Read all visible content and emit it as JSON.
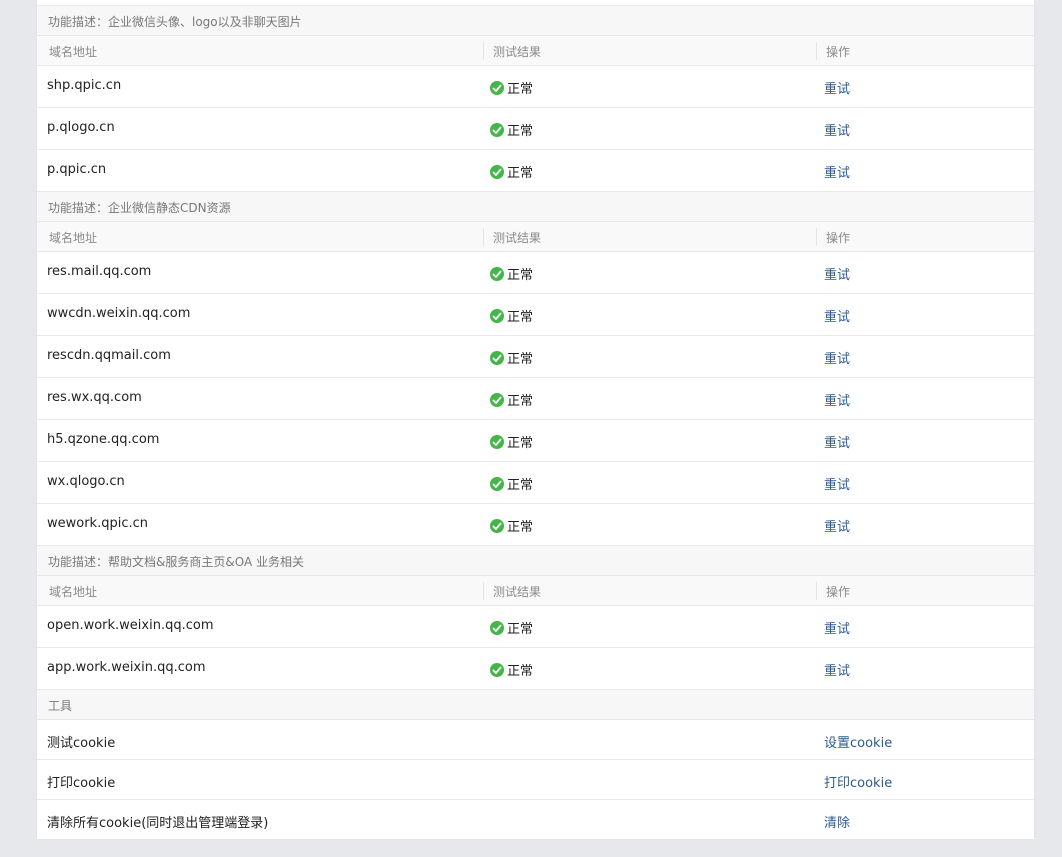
{
  "colors": {
    "ok_green": "#44b549",
    "link_blue": "#2b5b8c"
  },
  "table_headers": {
    "domain": "域名地址",
    "result": "测试结果",
    "action": "操作"
  },
  "groups": [
    {
      "description": "功能描述：企业微信头像、logo以及非聊天图片",
      "rows": [
        {
          "domain": "shp.qpic.cn",
          "status": "正常",
          "action": "重试"
        },
        {
          "domain": "p.qlogo.cn",
          "status": "正常",
          "action": "重试"
        },
        {
          "domain": "p.qpic.cn",
          "status": "正常",
          "action": "重试"
        }
      ]
    },
    {
      "description": "功能描述：企业微信静态CDN资源",
      "rows": [
        {
          "domain": "res.mail.qq.com",
          "status": "正常",
          "action": "重试"
        },
        {
          "domain": "wwcdn.weixin.qq.com",
          "status": "正常",
          "action": "重试"
        },
        {
          "domain": "rescdn.qqmail.com",
          "status": "正常",
          "action": "重试"
        },
        {
          "domain": "res.wx.qq.com",
          "status": "正常",
          "action": "重试"
        },
        {
          "domain": "h5.qzone.qq.com",
          "status": "正常",
          "action": "重试"
        },
        {
          "domain": "wx.qlogo.cn",
          "status": "正常",
          "action": "重试"
        },
        {
          "domain": "wework.qpic.cn",
          "status": "正常",
          "action": "重试"
        }
      ]
    },
    {
      "description": "功能描述：帮助文档&服务商主页&OA 业务相关",
      "rows": [
        {
          "domain": "open.work.weixin.qq.com",
          "status": "正常",
          "action": "重试"
        },
        {
          "domain": "app.work.weixin.qq.com",
          "status": "正常",
          "action": "重试"
        }
      ]
    }
  ],
  "tools": {
    "title": "工具",
    "rows": [
      {
        "label": "测试cookie",
        "action": "设置cookie"
      },
      {
        "label": "打印cookie",
        "action": "打印cookie"
      },
      {
        "label": "清除所有cookie(同时退出管理端登录)",
        "action": "清除"
      }
    ]
  }
}
